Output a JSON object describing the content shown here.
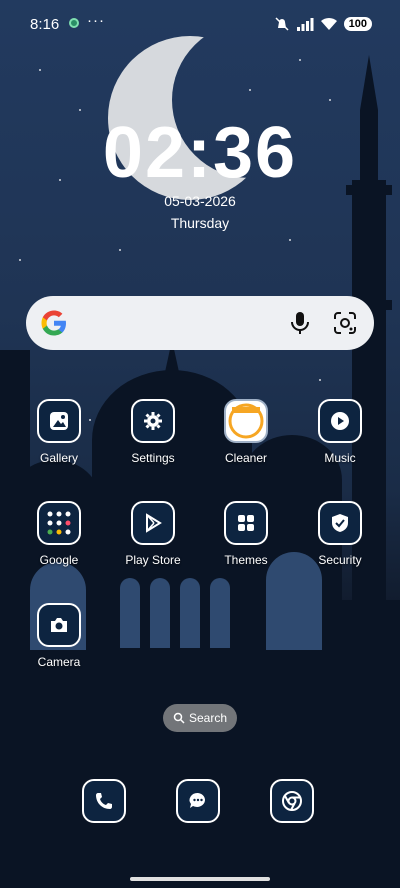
{
  "status_bar": {
    "time": "8:16",
    "more": "···",
    "battery": "100"
  },
  "clock": {
    "time": "02:36",
    "date": "05-03-2026",
    "day": "Thursday"
  },
  "search_bar": {
    "logo": "google-g-icon",
    "mic": "mic-icon",
    "lens": "lens-icon"
  },
  "apps": [
    {
      "label": "Gallery",
      "icon": "gallery-icon"
    },
    {
      "label": "Settings",
      "icon": "gear-icon"
    },
    {
      "label": "Cleaner",
      "icon": "cleaner-icon"
    },
    {
      "label": "Music",
      "icon": "play-icon"
    },
    {
      "label": "Google",
      "icon": "folder-icon"
    },
    {
      "label": "Play Store",
      "icon": "play-store-icon"
    },
    {
      "label": "Themes",
      "icon": "grid-icon"
    },
    {
      "label": "Security",
      "icon": "shield-icon"
    },
    {
      "label": "Camera",
      "icon": "camera-icon"
    }
  ],
  "search_pill": {
    "label": "Search"
  },
  "dock": [
    {
      "icon": "phone-icon"
    },
    {
      "icon": "chat-icon"
    },
    {
      "icon": "chrome-icon"
    }
  ],
  "colors": {
    "tile_bg": "#0d2440",
    "tile_border": "#ffffff",
    "search_bg": "#eef0f3"
  }
}
